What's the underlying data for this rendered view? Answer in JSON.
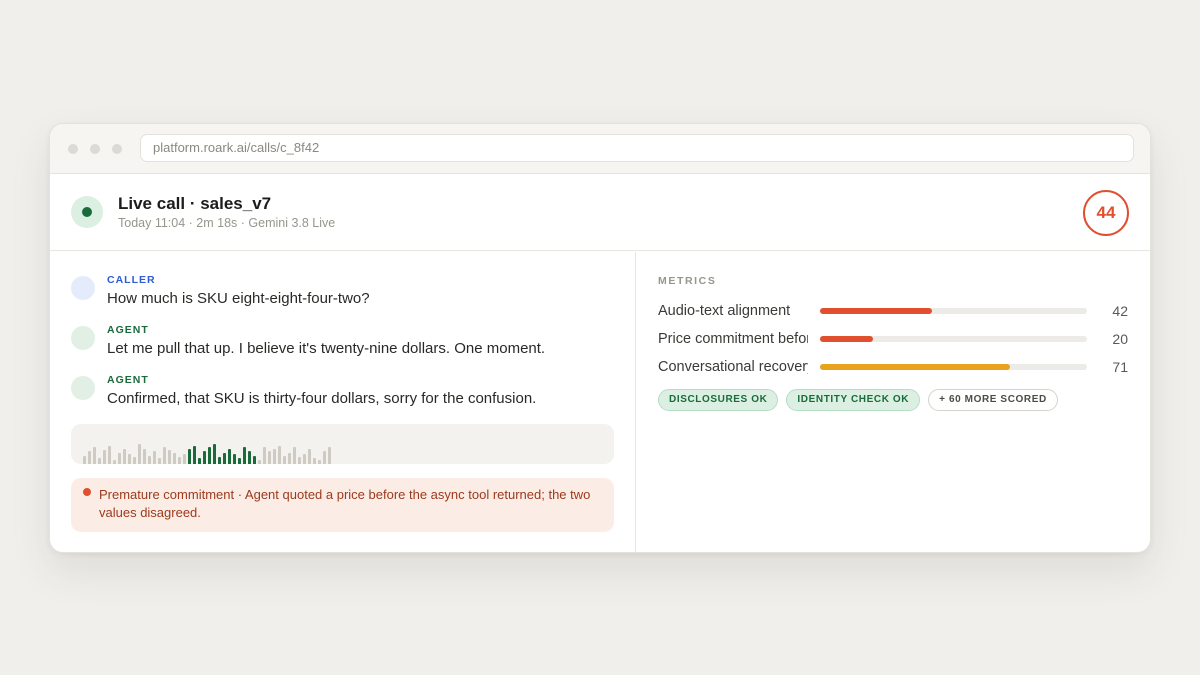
{
  "browser": {
    "url": "platform.roark.ai/calls/c_8f42"
  },
  "header": {
    "title": "Live call · sales_v7",
    "subtitle": "Today 11:04 · 2m 18s · Gemini 3.8 Live",
    "score": "44",
    "score_color": "#e0502e",
    "live_color": "#1a6b3c"
  },
  "transcript": [
    {
      "role": "CALLER",
      "text": "How much is SKU eight-eight-four-two?"
    },
    {
      "role": "AGENT",
      "text": "Let me pull that up. I believe it's twenty-nine dollars. One moment."
    },
    {
      "role": "AGENT",
      "text": "Confirmed, that SKU is thirty-four dollars, sorry for the confusion."
    }
  ],
  "waveform": {
    "active_color": "#1a6b3c",
    "idle_color": "#cfcbc2",
    "bars": [
      {
        "level": 0.3,
        "active": false
      },
      {
        "level": 0.45,
        "active": false
      },
      {
        "level": 0.6,
        "active": false
      },
      {
        "level": 0.2,
        "active": false
      },
      {
        "level": 0.5,
        "active": false
      },
      {
        "level": 0.65,
        "active": false
      },
      {
        "level": 0.15,
        "active": false
      },
      {
        "level": 0.4,
        "active": false
      },
      {
        "level": 0.55,
        "active": false
      },
      {
        "level": 0.35,
        "active": false
      },
      {
        "level": 0.25,
        "active": false
      },
      {
        "level": 0.7,
        "active": false
      },
      {
        "level": 0.55,
        "active": false
      },
      {
        "level": 0.3,
        "active": false
      },
      {
        "level": 0.45,
        "active": false
      },
      {
        "level": 0.2,
        "active": false
      },
      {
        "level": 0.6,
        "active": false
      },
      {
        "level": 0.5,
        "active": false
      },
      {
        "level": 0.4,
        "active": false
      },
      {
        "level": 0.25,
        "active": false
      },
      {
        "level": 0.35,
        "active": false
      },
      {
        "level": 0.55,
        "active": true
      },
      {
        "level": 0.65,
        "active": true
      },
      {
        "level": 0.2,
        "active": true
      },
      {
        "level": 0.45,
        "active": true
      },
      {
        "level": 0.6,
        "active": true
      },
      {
        "level": 0.7,
        "active": true
      },
      {
        "level": 0.25,
        "active": true
      },
      {
        "level": 0.4,
        "active": true
      },
      {
        "level": 0.55,
        "active": true
      },
      {
        "level": 0.35,
        "active": true
      },
      {
        "level": 0.2,
        "active": true
      },
      {
        "level": 0.6,
        "active": true
      },
      {
        "level": 0.45,
        "active": true
      },
      {
        "level": 0.3,
        "active": true
      },
      {
        "level": 0.15,
        "active": false
      },
      {
        "level": 0.6,
        "active": false
      },
      {
        "level": 0.45,
        "active": false
      },
      {
        "level": 0.55,
        "active": false
      },
      {
        "level": 0.65,
        "active": false
      },
      {
        "level": 0.3,
        "active": false
      },
      {
        "level": 0.4,
        "active": false
      },
      {
        "level": 0.6,
        "active": false
      },
      {
        "level": 0.25,
        "active": false
      },
      {
        "level": 0.35,
        "active": false
      },
      {
        "level": 0.55,
        "active": false
      },
      {
        "level": 0.2,
        "active": false
      },
      {
        "level": 0.15,
        "active": false
      },
      {
        "level": 0.45,
        "active": false
      },
      {
        "level": 0.6,
        "active": false
      }
    ]
  },
  "alert": {
    "text": "Premature commitment · Agent quoted a price before the async tool returned; the two values disagreed."
  },
  "metrics": {
    "heading": "METRICS",
    "items": [
      {
        "label": "Audio-text alignment",
        "value": "42",
        "percent": 42,
        "color": "#e0502e"
      },
      {
        "label": "Price commitment before tool result",
        "value": "20",
        "percent": 20,
        "color": "#e0502e"
      },
      {
        "label": "Conversational recovery",
        "value": "71",
        "percent": 71,
        "color": "#e8a21c"
      }
    ],
    "chips": [
      {
        "label": "DISCLOSURES OK",
        "style": "green"
      },
      {
        "label": "IDENTITY CHECK OK",
        "style": "green"
      },
      {
        "label": "+ 60 MORE SCORED",
        "style": "neutral"
      }
    ]
  }
}
